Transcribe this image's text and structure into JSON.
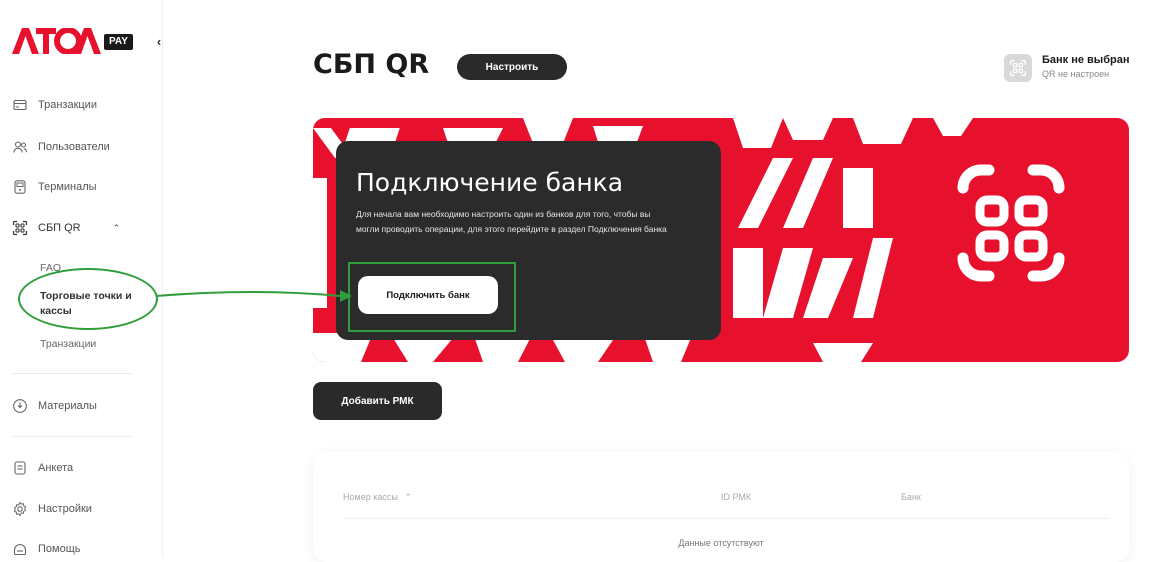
{
  "brand": {
    "logo": "ATOL",
    "badge": "PAY",
    "logo_color": "#e8112d"
  },
  "sidebar": {
    "collapse_glyph": "‹",
    "items": [
      {
        "label": "Транзакции",
        "icon": "card-icon"
      },
      {
        "label": "Пользователи",
        "icon": "users-icon"
      },
      {
        "label": "Терминалы",
        "icon": "terminal-icon"
      },
      {
        "label": "СБП QR",
        "icon": "qr-icon",
        "expanded": true
      },
      {
        "label": "Материалы",
        "icon": "materials-icon"
      },
      {
        "label": "Анкета",
        "icon": "form-icon"
      },
      {
        "label": "Настройки",
        "icon": "gear-icon"
      },
      {
        "label": "Помощь",
        "icon": "help-icon"
      }
    ],
    "sub_items": [
      {
        "label": "FAQ"
      },
      {
        "label": "Торговые точки и кассы",
        "active": true
      },
      {
        "label": "Транзакции"
      }
    ]
  },
  "header": {
    "title": "СБП QR",
    "setup_label": "Настроить",
    "bank_status": {
      "name": "Банк не выбран",
      "sub": "QR не настроен"
    }
  },
  "banner": {
    "card_title": "Подключение банка",
    "card_text": "Для начала вам необходимо настроить один из банков для того, чтобы вы могли проводить операции, для этого перейдите в раздел Подключения банка",
    "connect_label": "Подключить банк",
    "accent": "#e8112d"
  },
  "actions": {
    "add_rmk_label": "Добавить РМК"
  },
  "table": {
    "columns": [
      "Номер кассы",
      "ID РМК",
      "Банк"
    ],
    "empty_label": "Данные отсутствуют"
  },
  "colors": {
    "annotation": "#2f9e3a",
    "dark": "#2a2a2a"
  }
}
